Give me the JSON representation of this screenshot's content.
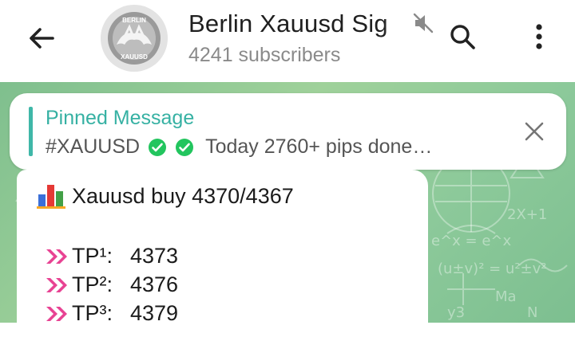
{
  "header": {
    "title": "Berlin Xauusd Sig",
    "subscribers": "4241 subscribers",
    "avatar_text_top": "BERLIN",
    "avatar_text_bottom": "XAUUSD"
  },
  "pinned": {
    "title": "Pinned Message",
    "hashtag": "#XAUUSD",
    "text": "Today 2760+ pips done…"
  },
  "message": {
    "headline": "Xauusd buy 4370/4367",
    "targets": [
      {
        "label": "TP¹:",
        "value": "4373"
      },
      {
        "label": "TP²:",
        "value": "4376"
      },
      {
        "label": "TP³:",
        "value": "4379"
      }
    ]
  },
  "colors": {
    "accent": "#36b1a3",
    "check": "#22c55e",
    "arrow": "#e84393",
    "chat_bg": "#8cc99a"
  },
  "icons": {
    "back": "back-arrow-icon",
    "mute": "mute-icon",
    "search": "search-icon",
    "more": "more-vertical-icon",
    "close": "close-icon",
    "check": "check-circle-icon",
    "chart": "bar-chart-icon",
    "forward": "double-chevron-icon"
  }
}
